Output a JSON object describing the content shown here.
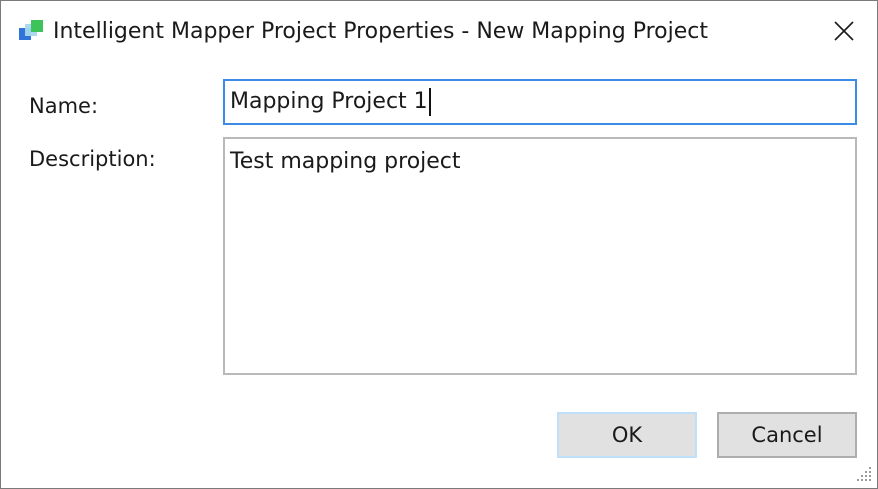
{
  "window": {
    "title": "Intelligent Mapper Project Properties - New Mapping Project",
    "app_icon": "intelligent-mapper-app-icon",
    "close_icon": "close-icon",
    "accent_color": "#3c8ce6"
  },
  "form": {
    "name_label": "Name:",
    "name_value": "Mapping Project 1",
    "description_label": "Description:",
    "description_value": "Test mapping project"
  },
  "buttons": {
    "ok_label": "OK",
    "cancel_label": "Cancel"
  }
}
